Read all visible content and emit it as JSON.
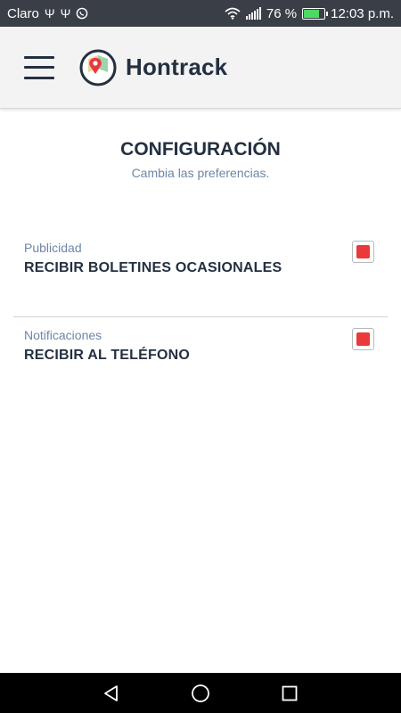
{
  "status_bar": {
    "carrier": "Claro",
    "notification_icons": [
      "usb-icon",
      "usb-icon",
      "whatsapp-icon"
    ],
    "battery_percent": "76 %",
    "time": "12:03 p.m."
  },
  "header": {
    "brand": "Hontrack"
  },
  "page": {
    "title": "CONFIGURACIÓN",
    "subtitle": "Cambia las preferencias."
  },
  "settings": [
    {
      "category": "Publicidad",
      "label": "RECIBIR BOLETINES OCASIONALES",
      "checked": true
    },
    {
      "category": "Notificaciones",
      "label": "RECIBIR AL TELÉFONO",
      "checked": true
    }
  ],
  "colors": {
    "header_bg": "#f3f3f3",
    "dark_text": "#243040",
    "muted_text": "#6d86a8",
    "checkbox_accent": "#e83a3a",
    "status_bar_bg": "#3a3f47"
  }
}
